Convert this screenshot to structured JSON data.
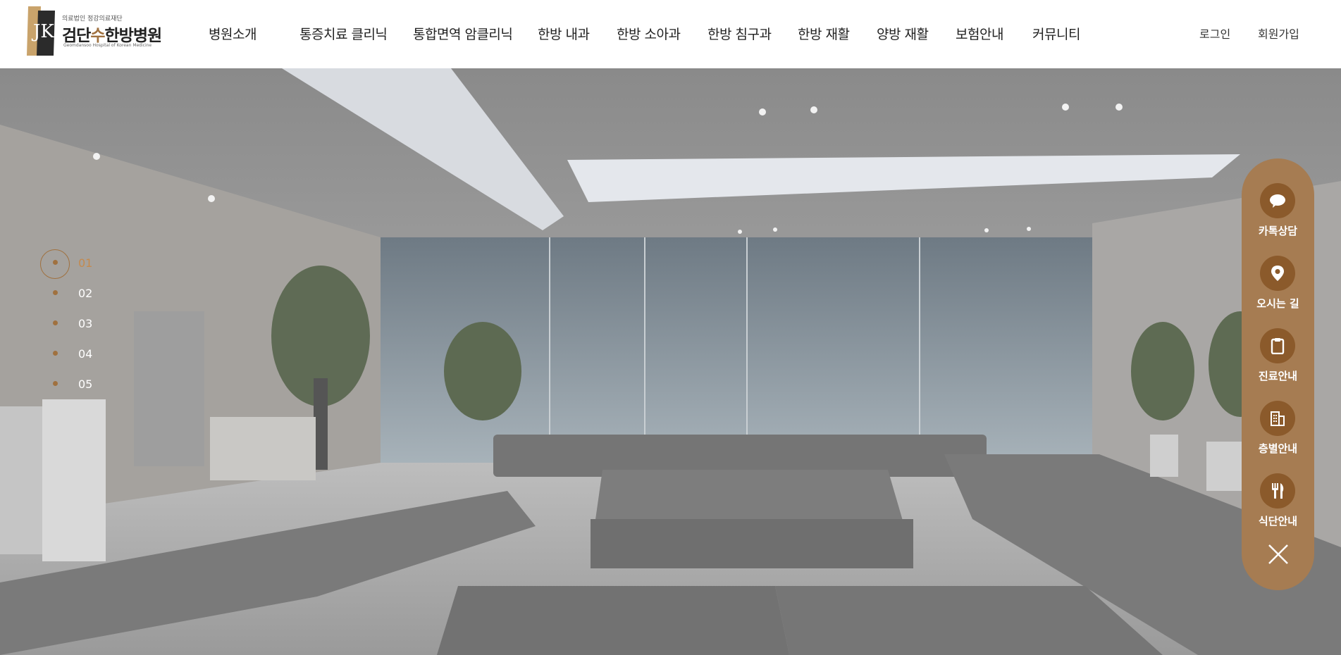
{
  "header": {
    "logo": {
      "subtitle": "의료법인 정강의료재단",
      "name_part1": "검단",
      "name_accent": "수",
      "name_part2": "한방병원",
      "english": "Geomdansoo Hospital of Korean Medicine"
    },
    "nav": [
      "병원소개",
      "통증치료 클리닉",
      "통합면역 암클리닉",
      "한방 내과",
      "한방 소아과",
      "한방 침구과",
      "한방 재활",
      "양방 재활",
      "보험안내",
      "커뮤니티"
    ],
    "util": {
      "login": "로그인",
      "join": "회원가입"
    }
  },
  "hero": {
    "pagination": [
      "01",
      "02",
      "03",
      "04",
      "05"
    ],
    "active_index": 0
  },
  "quick_menu": {
    "items": [
      {
        "label": "카톡상담",
        "icon": "chat-bubble-icon"
      },
      {
        "label": "오시는 길",
        "icon": "map-pin-icon"
      },
      {
        "label": "진료안내",
        "icon": "clipboard-icon"
      },
      {
        "label": "층별안내",
        "icon": "building-icon"
      },
      {
        "label": "식단안내",
        "icon": "fork-knife-icon"
      }
    ],
    "close_icon": "close-icon"
  },
  "colors": {
    "brand": "#a67c52",
    "brand_dark": "#8b5a2b",
    "accent_text": "#a0713f"
  }
}
